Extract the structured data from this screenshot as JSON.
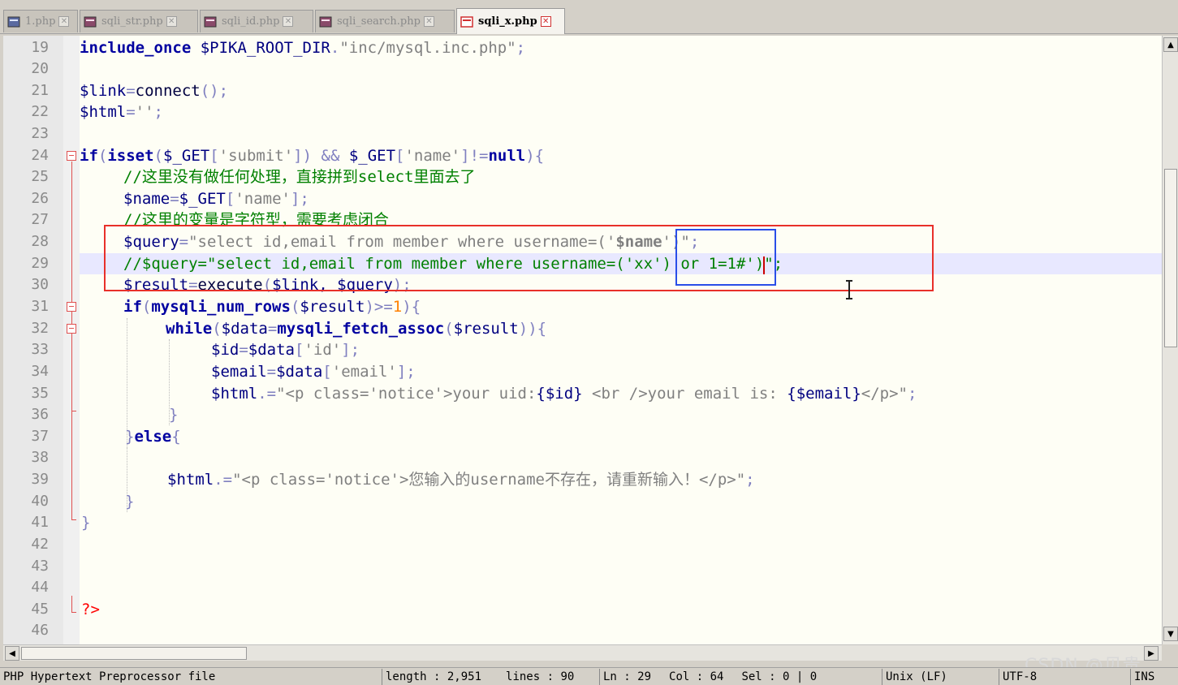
{
  "tabs": [
    {
      "label": "1.php",
      "active": false
    },
    {
      "label": "sqli_str.php",
      "active": false
    },
    {
      "label": "sqli_id.php",
      "active": false
    },
    {
      "label": "sqli_search.php",
      "active": false
    },
    {
      "label": "sqli_x.php",
      "active": true
    }
  ],
  "tab_close_glyph": "✕",
  "line_numbers": [
    "19",
    "20",
    "21",
    "22",
    "23",
    "24",
    "25",
    "26",
    "27",
    "28",
    "29",
    "30",
    "31",
    "32",
    "33",
    "34",
    "35",
    "36",
    "37",
    "38",
    "39",
    "40",
    "41",
    "42",
    "43",
    "44",
    "45",
    "46"
  ],
  "current_line": "29",
  "code": {
    "l19": {
      "kw": "include_once",
      "rest_var": " $PIKA_ROOT_DIR",
      "op": ".",
      "str": "\"inc/mysql.inc.php\"",
      "end": ";"
    },
    "l21": {
      "var": "$link",
      "op": "=",
      "fn": "connect",
      "p": "();"
    },
    "l22": {
      "var": "$html",
      "op": "=",
      "str": "''",
      "end": ";"
    },
    "l24": {
      "kw1": "if",
      "p1": "(",
      "kw2": "isset",
      "p2": "(",
      "var1": "$_GET",
      "p3": "[",
      "s1": "'submit'",
      "p4": "])",
      "op": " && ",
      "var2": "$_GET",
      "p5": "[",
      "s2": "'name'",
      "p6": "]",
      "op2": "!=",
      "kw3": "null",
      "p7": "){"
    },
    "l25": "//这里没有做任何处理，直接拼到select里面去了",
    "l26": {
      "var": "$name",
      "op": "=",
      "var2": "$_GET",
      "p": "[",
      "s": "'name'",
      "end": "];"
    },
    "l27": "//这里的变量是字符型，需要考虑闭合",
    "l28": {
      "var": "$query",
      "op": "=",
      "s1": "\"select id,email from member where username=",
      "p1": "('",
      "bold": "$name",
      "p2": "')",
      "s2": "\"",
      "end": ";"
    },
    "l29": "//$query=\"select id,email from member where username=('xx') or 1=1#')\";",
    "l30": {
      "var": "$result",
      "op": "=",
      "fn": "execute",
      "p": "(",
      "args": "$link, $query",
      "end": ");"
    },
    "l31": {
      "kw": "if",
      "p1": "(",
      "fn": "mysqli_num_rows",
      "p2": "(",
      "var": "$result",
      "p3": ")>=",
      "num": "1",
      "end": "){"
    },
    "l32": {
      "kw": "while",
      "p1": "(",
      "var": "$data",
      "op": "=",
      "fn": "mysqli_fetch_assoc",
      "p2": "(",
      "var2": "$result",
      "end": ")){"
    },
    "l33": {
      "var": "$id",
      "op": "=",
      "var2": "$data",
      "p": "[",
      "s": "'id'",
      "end": "];"
    },
    "l34": {
      "var": "$email",
      "op": "=",
      "var2": "$data",
      "p": "[",
      "s": "'email'",
      "end": "];"
    },
    "l35": {
      "var": "$html",
      "op": ".=",
      "s1": "\"<p class='notice'>your uid:",
      "v1": "{$id}",
      "s2": " <br />your email is: ",
      "v2": "{$email}",
      "s3": "</p>\"",
      "end": ";"
    },
    "l36": "}",
    "l37": {
      "p1": "}",
      "kw": "else",
      "p2": "{"
    },
    "l39": {
      "var": "$html",
      "op": ".=",
      "s": "\"<p class='notice'>您输入的username不存在，请重新输入！</p>\"",
      "end": ";"
    },
    "l40": "}",
    "l41": "}",
    "l45": "?>"
  },
  "status": {
    "filetype": "PHP Hypertext Preprocessor file",
    "length": "length : 2,951",
    "lines": "lines : 90",
    "ln": "Ln : 29",
    "col": "Col : 64",
    "sel": "Sel : 0 | 0",
    "eol": "Unix (LF)",
    "encoding": "UTF-8",
    "mode": "INS"
  },
  "watermark": "CSDN @贝贵",
  "colors": {
    "annotation_red": "#e8302a",
    "annotation_blue": "#2a4ee8",
    "current_line_bg": "#e8e8ff"
  },
  "icons": {
    "tab_file": "php-file-icon",
    "close": "close-icon",
    "fold": "fold-minus-icon",
    "scroll_up": "arrow-up-icon",
    "scroll_down": "arrow-down-icon",
    "scroll_left": "arrow-left-icon",
    "scroll_right": "arrow-right-icon",
    "text_cursor": "ibeam-cursor-icon"
  }
}
